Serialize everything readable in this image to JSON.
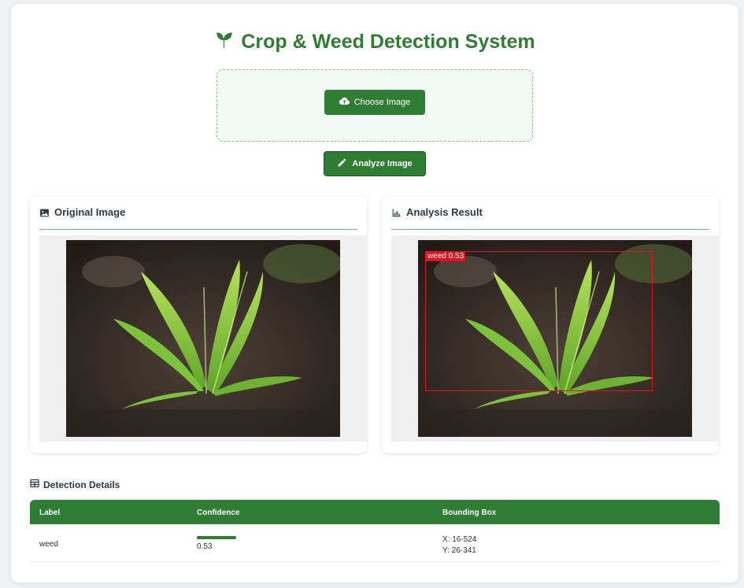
{
  "app": {
    "title": "Crop & Weed Detection System"
  },
  "upload": {
    "choose_label": "Choose Image",
    "analyze_label": "Analyze Image"
  },
  "panels": {
    "original_title": "Original Image",
    "result_title": "Analysis Result"
  },
  "detection": {
    "overlay_label": "weed 0.53"
  },
  "details": {
    "title": "Detection Details",
    "columns": [
      "Label",
      "Confidence",
      "Bounding Box"
    ],
    "rows": [
      {
        "label": "weed",
        "confidence": "0.53",
        "confidence_value": 0.53,
        "bbox_x": "X: 16-524",
        "bbox_y": "Y: 26-341"
      }
    ]
  },
  "icons": {
    "title": "seedling-icon",
    "choose": "cloud-upload-icon",
    "analyze": "pencil-icon",
    "original": "image-icon",
    "result": "bar-chart-icon",
    "details": "table-icon"
  },
  "colors": {
    "brand_green": "#2e7d32",
    "bbox_red": "#e0141e",
    "upload_bg": "#f2f9f2"
  }
}
